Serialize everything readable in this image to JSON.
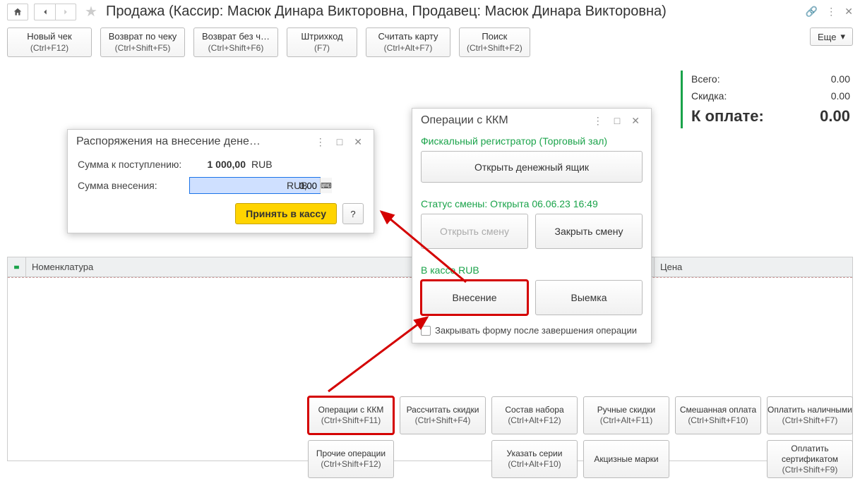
{
  "titlebar": {
    "title": "Продажа (Кассир: Масюк Динара Викторовна, Продавец: Масюк Динара Викторовна)"
  },
  "toolbar": {
    "new_check": {
      "label": "Новый чек",
      "hint": "(Ctrl+F12)"
    },
    "return_check": {
      "label": "Возврат по чеку",
      "hint": "(Ctrl+Shift+F5)"
    },
    "return_nocheck": {
      "label": "Возврат без ч…",
      "hint": "(Ctrl+Shift+F6)"
    },
    "barcode": {
      "label": "Штрихкод",
      "hint": "(F7)"
    },
    "read_card": {
      "label": "Считать карту",
      "hint": "(Ctrl+Alt+F7)"
    },
    "search": {
      "label": "Поиск",
      "hint": "(Ctrl+Shift+F2)"
    },
    "more": "Еще"
  },
  "totals": {
    "total_label": "Всего:",
    "total_value": "0.00",
    "discount_label": "Скидка:",
    "discount_value": "0.00",
    "pay_label": "К оплате:",
    "pay_value": "0.00"
  },
  "table": {
    "col_name": "Номенклатура",
    "col_price": "Цена"
  },
  "bottom": {
    "kkm": {
      "label": "Операции с ККМ",
      "hint": "(Ctrl+Shift+F11)"
    },
    "calc_discount": {
      "label": "Рассчитать скидки",
      "hint": "(Ctrl+Shift+F4)"
    },
    "set_content": {
      "label": "Состав набора",
      "hint": "(Ctrl+Alt+F12)"
    },
    "manual_disc": {
      "label": "Ручные скидки",
      "hint": "(Ctrl+Alt+F11)"
    },
    "mixed_pay": {
      "label": "Смешанная оплата",
      "hint": "(Ctrl+Shift+F10)"
    },
    "pay_cash": {
      "label": "Оплатить наличными",
      "hint": "(Ctrl+Shift+F7)"
    },
    "other_ops": {
      "label": "Прочие операции",
      "hint": "(Ctrl+Shift+F12)"
    },
    "series": {
      "label": "Указать серии",
      "hint": "(Ctrl+Alt+F10)"
    },
    "excise": {
      "label": "Акцизные марки",
      "hint": ""
    },
    "pay_cert": {
      "label": "Оплатить сертификатом",
      "hint": "(Ctrl+Shift+F9)"
    }
  },
  "kkm_popup": {
    "title": "Операции с ККМ",
    "fiscal": "Фискальный регистратор (Торговый зал)",
    "open_drawer": "Открыть денежный ящик",
    "shift_status": "Статус смены: Открыта 06.06.23 16:49",
    "open_shift": "Открыть смену",
    "close_shift": "Закрыть смену",
    "cash_label": "В кассе RUB",
    "deposit": "Внесение",
    "withdraw": "Выемка",
    "close_after": "Закрывать форму после завершения операции"
  },
  "deposit_popup": {
    "title": "Распоряжения на внесение дене…",
    "sum_expected_label": "Сумма к поступлению:",
    "sum_expected_value": "1 000,00",
    "currency": "RUB",
    "sum_deposit_label": "Сумма внесения:",
    "sum_deposit_value": "0,00",
    "accept": "Принять в кассу",
    "help": "?"
  }
}
